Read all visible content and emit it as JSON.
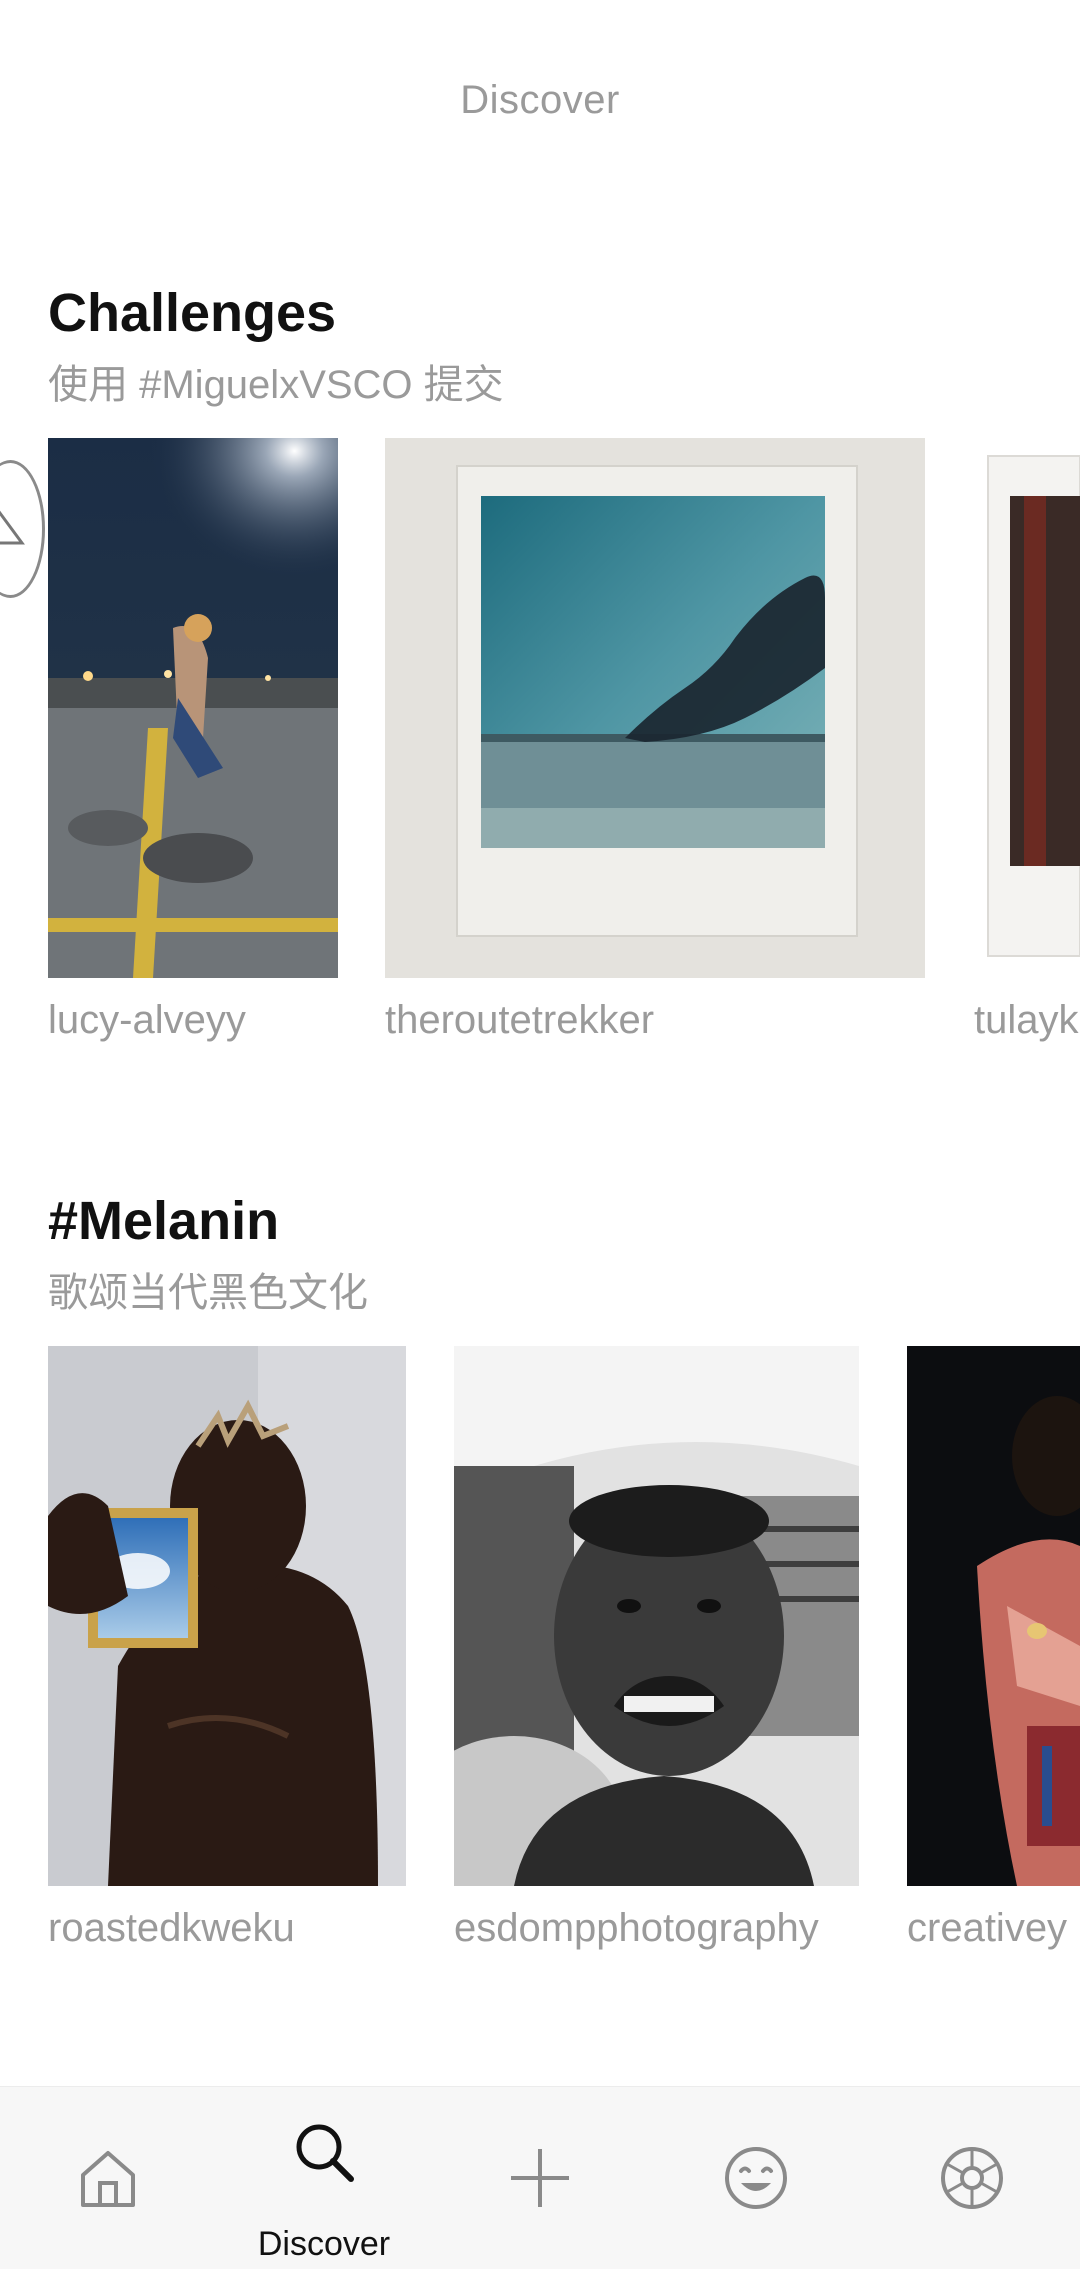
{
  "header": {
    "title": "Discover"
  },
  "sections": [
    {
      "title": "Challenges",
      "subtitle": "使用 #MiguelxVSCO 提交",
      "items": [
        {
          "username": "lucy-alveyy"
        },
        {
          "username": "theroutetrekker"
        },
        {
          "username": "tulayk"
        }
      ]
    },
    {
      "title": "#Melanin",
      "subtitle": "歌颂当代黑色文化",
      "items": [
        {
          "username": "roastedkweku"
        },
        {
          "username": "esdompphotography"
        },
        {
          "username": "creativey"
        }
      ]
    }
  ],
  "bottom_nav": {
    "items": [
      {
        "icon": "home-icon",
        "label": ""
      },
      {
        "icon": "search-icon",
        "label": "Discover",
        "active": true
      },
      {
        "icon": "plus-icon",
        "label": ""
      },
      {
        "icon": "smiley-icon",
        "label": ""
      },
      {
        "icon": "aperture-icon",
        "label": ""
      }
    ]
  }
}
